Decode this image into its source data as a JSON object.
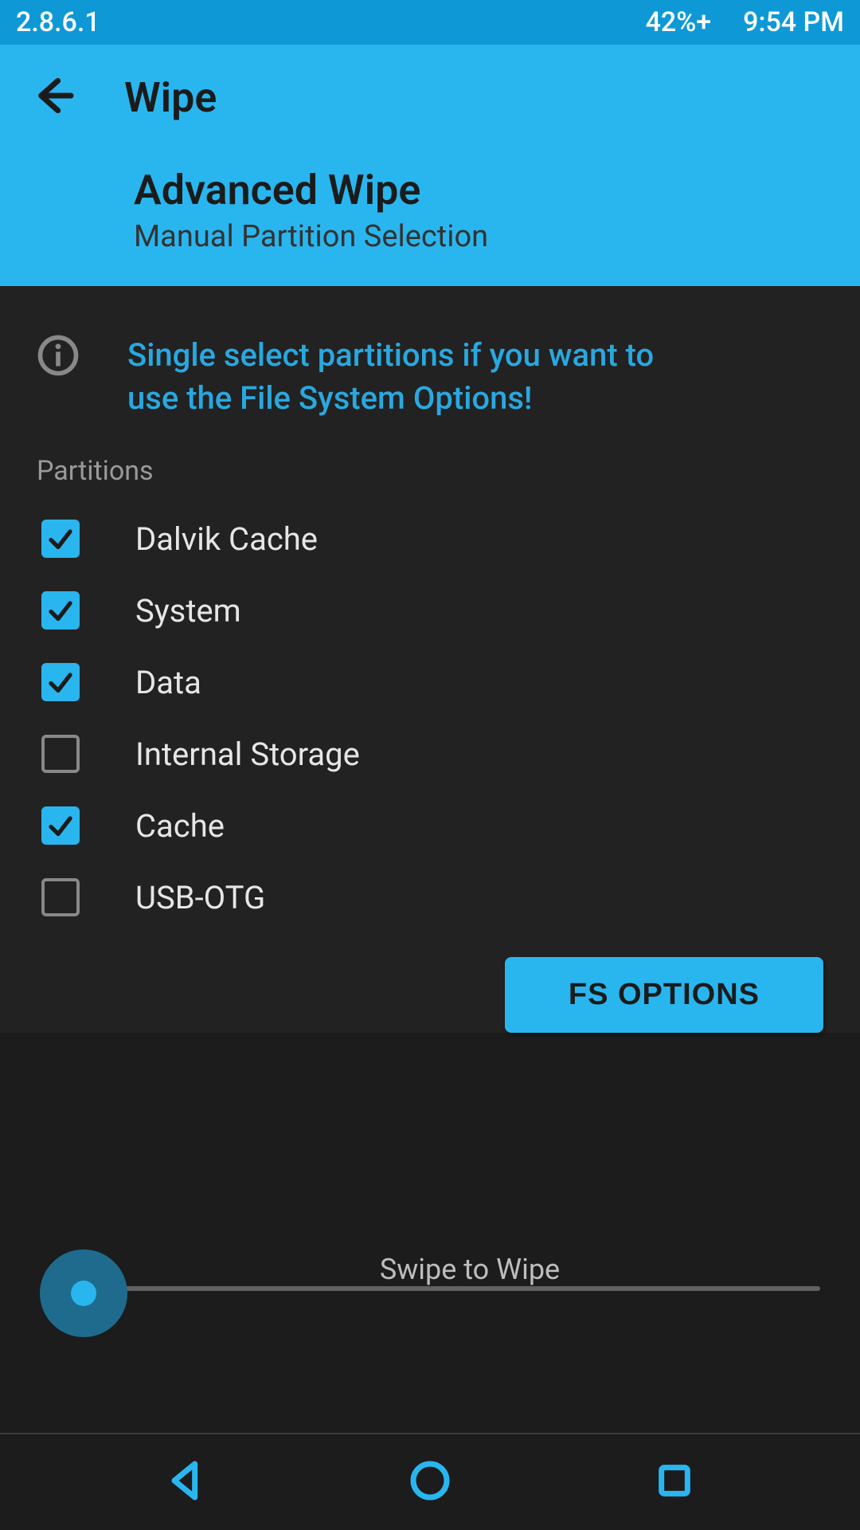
{
  "status": {
    "version": "2.8.6.1",
    "battery": "42%+",
    "time": "9:54 PM"
  },
  "header": {
    "title": "Wipe",
    "subtitle": "Advanced Wipe",
    "description": "Manual Partition Selection"
  },
  "info": {
    "text": "Single select partitions if you want to use the File System Options!"
  },
  "partitions": {
    "section_label": "Partitions",
    "items": [
      {
        "label": "Dalvik Cache",
        "checked": true
      },
      {
        "label": "System",
        "checked": true
      },
      {
        "label": "Data",
        "checked": true
      },
      {
        "label": "Internal Storage",
        "checked": false
      },
      {
        "label": "Cache",
        "checked": true
      },
      {
        "label": "USB-OTG",
        "checked": false
      }
    ]
  },
  "buttons": {
    "fs_options": "FS OPTIONS"
  },
  "swipe": {
    "label": "Swipe to Wipe"
  },
  "colors": {
    "accent": "#29b6ef",
    "status_bar": "#0e99d6",
    "bg": "#222222"
  }
}
